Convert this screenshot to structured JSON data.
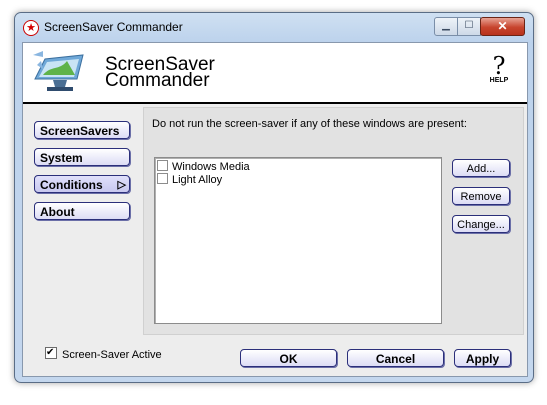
{
  "window": {
    "title": "ScreenSaver Commander"
  },
  "header": {
    "brand_line1": "ScreenSaver",
    "brand_line2": "Commander",
    "help_label": "HELP"
  },
  "nav": [
    {
      "label": "ScreenSavers"
    },
    {
      "label": "System"
    },
    {
      "label": "Conditions",
      "active": true
    },
    {
      "label": "About"
    }
  ],
  "conditions": {
    "instruction": "Do not run the screen-saver if any of these windows are present:",
    "windows": [
      {
        "label": "Windows Media",
        "checked": false
      },
      {
        "label": "Light Alloy",
        "checked": false
      }
    ],
    "buttons": {
      "add": "Add...",
      "remove": "Remove",
      "change": "Change..."
    }
  },
  "footer": {
    "active_label": "Screen-Saver Active",
    "active_checked": true,
    "ok": "OK",
    "cancel": "Cancel",
    "apply": "Apply"
  }
}
